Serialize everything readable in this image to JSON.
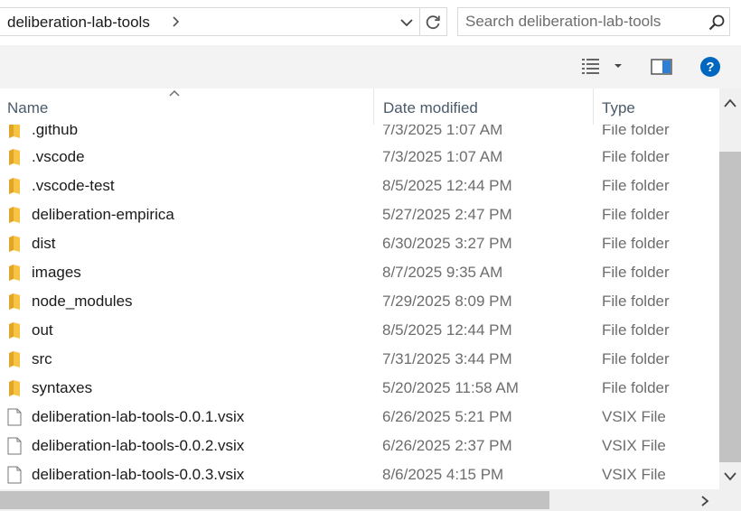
{
  "address": {
    "path_segment": "deliberation-lab-tools"
  },
  "search": {
    "placeholder": "Search deliberation-lab-tools"
  },
  "columns": {
    "name": "Name",
    "date_modified": "Date modified",
    "type": "Type"
  },
  "files": [
    {
      "name": ".github",
      "date": "7/3/2025 1:07 AM",
      "type": "File folder",
      "icon": "folder-icon"
    },
    {
      "name": ".vscode",
      "date": "7/3/2025 1:07 AM",
      "type": "File folder",
      "icon": "folder-icon"
    },
    {
      "name": ".vscode-test",
      "date": "8/5/2025 12:44 PM",
      "type": "File folder",
      "icon": "folder-icon"
    },
    {
      "name": "deliberation-empirica",
      "date": "5/27/2025 2:47 PM",
      "type": "File folder",
      "icon": "folder-icon"
    },
    {
      "name": "dist",
      "date": "6/30/2025 3:27 PM",
      "type": "File folder",
      "icon": "folder-icon"
    },
    {
      "name": "images",
      "date": "8/7/2025 9:35 AM",
      "type": "File folder",
      "icon": "folder-icon"
    },
    {
      "name": "node_modules",
      "date": "7/29/2025 8:09 PM",
      "type": "File folder",
      "icon": "folder-icon"
    },
    {
      "name": "out",
      "date": "8/5/2025 12:44 PM",
      "type": "File folder",
      "icon": "folder-icon"
    },
    {
      "name": "src",
      "date": "7/31/2025 3:44 PM",
      "type": "File folder",
      "icon": "folder-icon"
    },
    {
      "name": "syntaxes",
      "date": "5/20/2025 11:58 AM",
      "type": "File folder",
      "icon": "folder-icon"
    },
    {
      "name": "deliberation-lab-tools-0.0.1.vsix",
      "date": "6/26/2025 5:21 PM",
      "type": "VSIX File",
      "icon": "file-icon"
    },
    {
      "name": "deliberation-lab-tools-0.0.2.vsix",
      "date": "6/26/2025 2:37 PM",
      "type": "VSIX File",
      "icon": "file-icon"
    },
    {
      "name": "deliberation-lab-tools-0.0.3.vsix",
      "date": "8/6/2025 4:15 PM",
      "type": "VSIX File",
      "icon": "file-icon"
    }
  ],
  "colors": {
    "folder": "#f6c342",
    "help_accent": "#0067c0"
  }
}
